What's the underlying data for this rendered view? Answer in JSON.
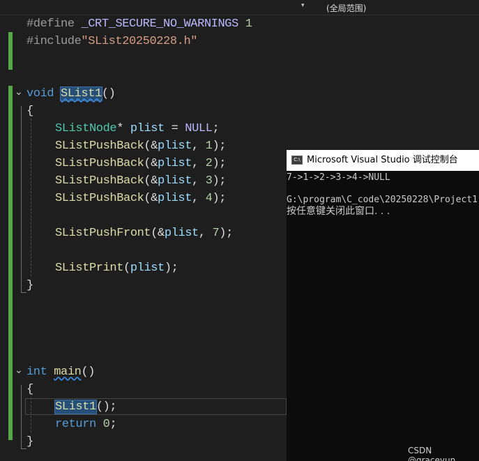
{
  "toolbar": {
    "scope_dropdown": "▾",
    "scope_label": "(全局范围)"
  },
  "code": {
    "l1_directive": "#define",
    "l1_macro": "_CRT_SECURE_NO_WARNINGS",
    "l1_value": "1",
    "l2_directive": "#include",
    "l2_string": "\"SList20250228.h\"",
    "l4_kw": "void",
    "l4_fn": "SList1",
    "l4_paren": "()",
    "l5_brace": "{",
    "l6_type": "SListNode",
    "l6_star": "*",
    "l6_var": "plist",
    "l6_eq": "=",
    "l6_null": "NULL",
    "l6_semi": ";",
    "push_fn": "SListPushBack",
    "push_amp": "(&",
    "push_var": "plist",
    "push_sep": ", ",
    "push_end": ");",
    "push_vals": [
      "1",
      "2",
      "3",
      "4"
    ],
    "front_fn": "SListPushFront",
    "front_val": "7",
    "print_fn": "SListPrint",
    "print_open": "(",
    "print_var": "plist",
    "print_close": ");",
    "close_brace": "}",
    "main_kw": "int",
    "main_fn": "main",
    "main_paren": "()",
    "call_fn": "SList1",
    "call_rest": "();",
    "ret_kw": "return",
    "ret_val": "0",
    "ret_semi": ";"
  },
  "console": {
    "icon": "C:\\",
    "title": "Microsoft Visual Studio 调试控制台",
    "line1": "7->1->2->3->4->NULL",
    "line2": "",
    "line3": "G:\\program\\C_code\\20250228\\Project1",
    "line4": "按任意键关闭此窗口. . ."
  },
  "watermark": "CSDN @graceyun"
}
